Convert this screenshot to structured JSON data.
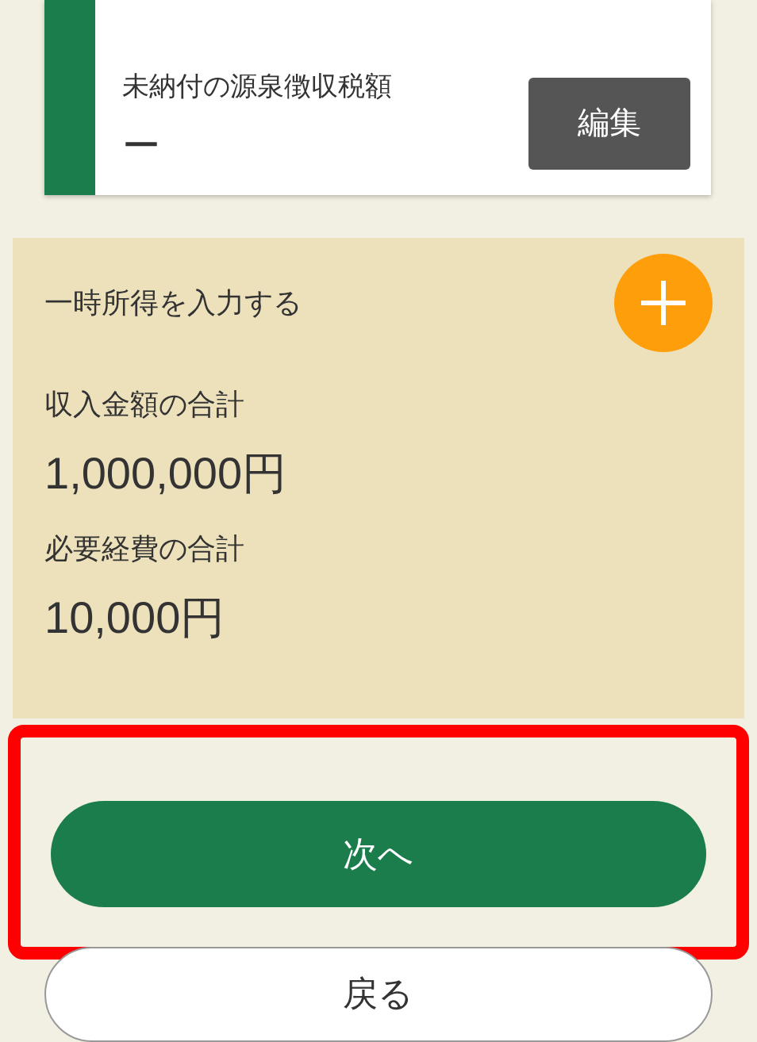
{
  "withholding_card": {
    "label": "未納付の源泉徴収税額",
    "value": "ー",
    "edit_button": "編集"
  },
  "temporary_income": {
    "heading": "一時所得を入力する",
    "fields": [
      {
        "label": "収入金額の合計",
        "value": "1,000,000円"
      },
      {
        "label": "必要経費の合計",
        "value": "10,000円"
      }
    ]
  },
  "footer": {
    "highlighted": true,
    "next_button": "次へ",
    "back_button": "戻る"
  }
}
